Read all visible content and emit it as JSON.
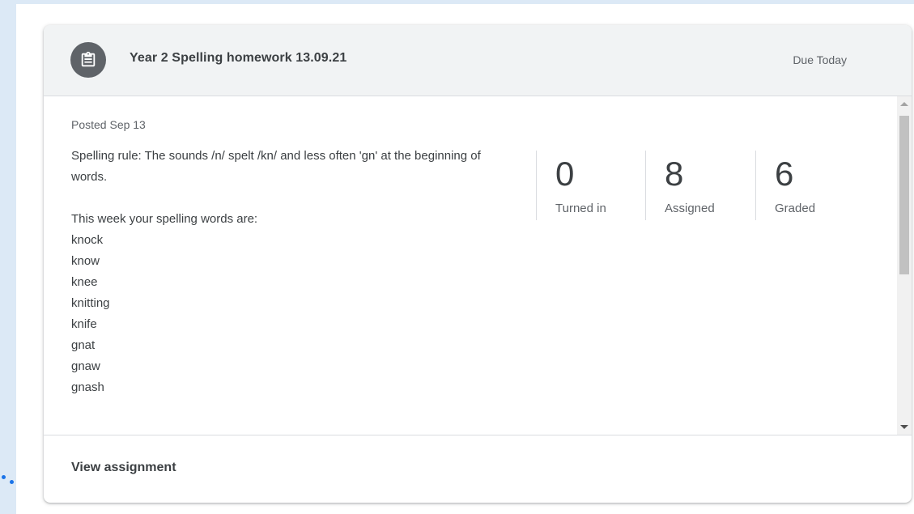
{
  "assignment": {
    "title": "Year 2 Spelling homework 13.09.21",
    "due": "Due Today",
    "posted": "Posted Sep 13",
    "rule_line": "Spelling rule: The sounds /n/ spelt /kn/ and less often 'gn' at the beginning of words.",
    "intro": "This week your spelling words are:",
    "words": [
      "knock",
      "know",
      "knee",
      "knitting",
      "knife",
      "gnat",
      "gnaw",
      "gnash"
    ],
    "icon": "assignment-icon"
  },
  "stats": [
    {
      "value": "0",
      "label": "Turned in"
    },
    {
      "value": "8",
      "label": "Assigned"
    },
    {
      "value": "6",
      "label": "Graded"
    }
  ],
  "footer": {
    "view_label": "View assignment"
  },
  "colors": {
    "header_bg": "#f1f3f4",
    "icon_bg": "#5f6368",
    "text": "#3c4043",
    "muted": "#5f6368",
    "accent": "#1a73e8",
    "side_bg": "#dce9f6"
  }
}
